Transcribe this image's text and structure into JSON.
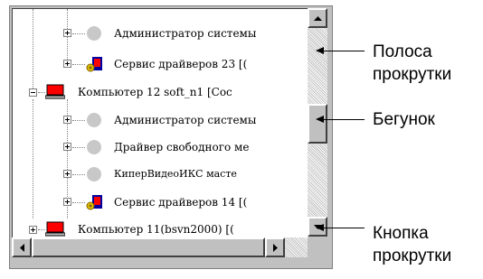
{
  "tree": {
    "rows": [
      {
        "label": "Администратор системы"
      },
      {
        "label": "Сервис драйверов 23 [("
      },
      {
        "label": "Компьютер 12 soft_n1 [Сос"
      },
      {
        "label": "Администратор системы"
      },
      {
        "label": "Драйвер свободного ме"
      },
      {
        "label": "КиперВидеоИКС масте"
      },
      {
        "label": "Сервис драйверов 14 [("
      },
      {
        "label": "Компьютер 11(bsvn2000) [("
      }
    ]
  },
  "callouts": {
    "scrollbar": "Полоса\nпрокрутки",
    "thumb": "Бегунок",
    "button": "Кнопка\nпрокрутки"
  },
  "colors": {
    "computer_icon_red": "#ff0000",
    "service_icon_blue": "#0000a0",
    "window_grey": "#c0c0c0"
  },
  "icons": {
    "person": "grey-circle-icon",
    "service": "driver-service-icon",
    "computer": "computer-icon"
  }
}
